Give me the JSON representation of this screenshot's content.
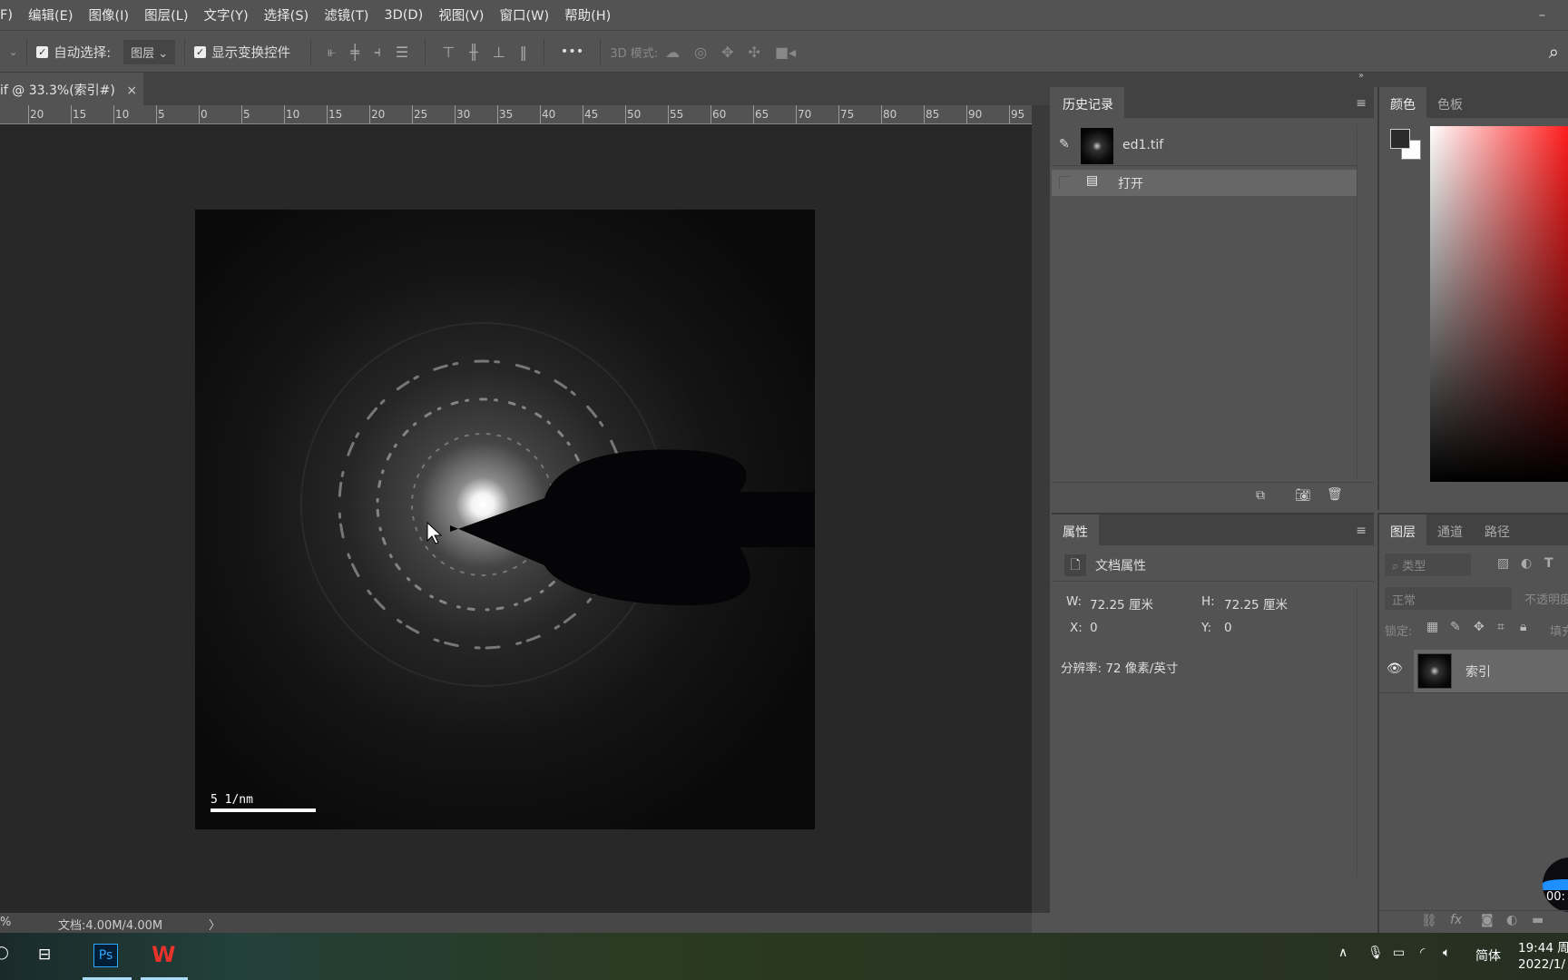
{
  "menu": [
    "F)",
    "编辑(E)",
    "图像(I)",
    "图层(L)",
    "文字(Y)",
    "选择(S)",
    "滤镜(T)",
    "3D(D)",
    "视图(V)",
    "窗口(W)",
    "帮助(H)"
  ],
  "options": {
    "auto_select": "自动选择:",
    "auto_select_value": "图层",
    "show_transform": "显示变换控件",
    "more": "•••",
    "mode_3d": "3D 模式:"
  },
  "doc_tab": {
    "title": "if @ 33.3%(索引#)",
    "close": "×"
  },
  "ruler": [
    "20",
    "15",
    "10",
    "5",
    "0",
    "5",
    "10",
    "15",
    "20",
    "25",
    "30",
    "35",
    "40",
    "45",
    "50",
    "55",
    "60",
    "65",
    "70",
    "75",
    "80",
    "85",
    "90",
    "95"
  ],
  "image": {
    "scale_label": "5 1/nm"
  },
  "status": {
    "zoom": "%",
    "doc": "文档:4.00M/4.00M",
    "arrow": "〉"
  },
  "history": {
    "tab": "历史记录",
    "snapshot": "ed1.tif",
    "items": [
      {
        "label": "打开"
      }
    ]
  },
  "properties": {
    "tab": "属性",
    "title": "文档属性",
    "w_label": "W:",
    "w": "72.25 厘米",
    "h_label": "H:",
    "h": "72.25 厘米",
    "x_label": "X:",
    "x": "0",
    "y_label": "Y:",
    "y": "0",
    "resolution": "分辨率: 72 像素/英寸"
  },
  "color": {
    "tabs": [
      "颜色",
      "色板"
    ],
    "hue": "#ff0000",
    "fg": "#2b2b2b",
    "bg": "#ffffff"
  },
  "layers": {
    "tabs": [
      "图层",
      "通道",
      "路径"
    ],
    "filter": "类型",
    "blend": "正常",
    "opacity": "不透明度",
    "lock": "锁定:",
    "fill": "填充",
    "layer_name": "索引",
    "recorder": "00:"
  },
  "taskbar": {
    "ps": "Ps",
    "ime": "简体",
    "time": "19:44 周",
    "date": "2022/1/"
  }
}
